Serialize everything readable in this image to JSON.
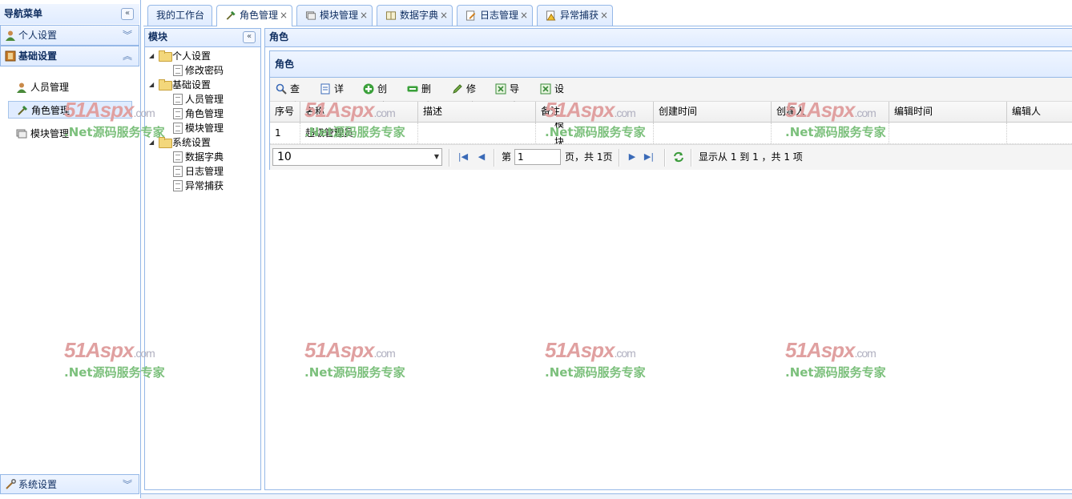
{
  "nav": {
    "title": "导航菜单",
    "sections": {
      "personal": "个人设置",
      "basic": "基础设置",
      "system": "系统设置"
    },
    "items": [
      "人员管理",
      "角色管理",
      "模块管理"
    ]
  },
  "tabs": [
    {
      "label": "我的工作台"
    },
    {
      "label": "角色管理"
    },
    {
      "label": "模块管理"
    },
    {
      "label": "数据字典"
    },
    {
      "label": "日志管理"
    },
    {
      "label": "异常捕获"
    }
  ],
  "module_panel": {
    "title": "模块",
    "tree": [
      "个人设置",
      "修改密码",
      "基础设置",
      "人员管理",
      "角色管理",
      "模块管理",
      "系统设置",
      "数据字典",
      "日志管理",
      "异常捕获"
    ]
  },
  "role_panel": {
    "title": "角色",
    "grid_title": "角色",
    "toolbar": [
      "查询",
      "详细",
      "创建",
      "删除",
      "修改",
      "导出",
      "设置模块"
    ],
    "columns": [
      "序号",
      "名称",
      "描述",
      "备注",
      "创建时间",
      "创建人",
      "编辑时间",
      "编辑人"
    ],
    "rows": [
      [
        "1",
        "超级管理员",
        "",
        "",
        "",
        "",
        "",
        ""
      ]
    ]
  },
  "pager": {
    "page_size": "10",
    "page_prefix": "第",
    "page_value": "1",
    "page_suffix": "页，共 1页",
    "summary": "显示从 1 到 1 ，共 1 项"
  },
  "watermark": {
    "brand": "51Aspx",
    "brand_suffix": ".com",
    "slogan": ".Net源码服务专家"
  }
}
